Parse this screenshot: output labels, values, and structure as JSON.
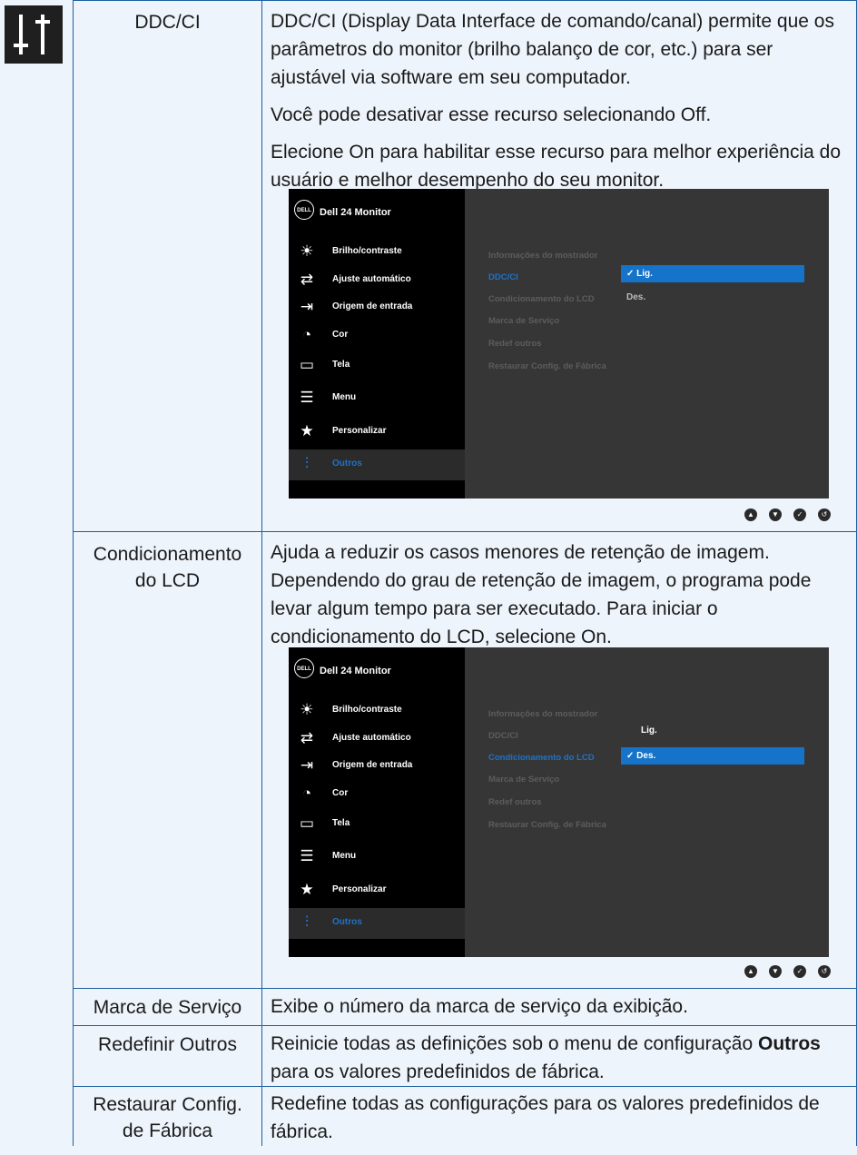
{
  "rows": [
    {
      "label": "DDC/CI",
      "desc": [
        "DDC/CI (Display Data Interface de comando/canal) permite que os parâmetros do monitor (brilho balanço de cor, etc.) para ser ajustável via software em seu computador.",
        "Você pode desativar esse recurso selecionando Off.",
        "Elecione On para habilitar esse recurso para melhor experiência do usuário e melhor desempenho do seu monitor."
      ]
    },
    {
      "label_line1": "Condicionamento",
      "label_line2": "do LCD",
      "desc": "Ajuda a reduzir os casos menores de retenção de imagem. Dependendo do grau de retenção de imagem, o programa pode levar algum tempo para ser executado. Para iniciar o condicionamento do LCD, selecione On."
    },
    {
      "label": "Marca de Serviço",
      "desc": "Exibe o número da marca de serviço da exibição."
    },
    {
      "label": "Redefinir Outros",
      "desc_before": "Reinicie todas as definições sob o menu de configuração ",
      "desc_bold": "Outros",
      "desc_after": " para os valores predefinidos de fábrica."
    },
    {
      "label_line1": "Restaurar Config.",
      "label_line2": "de Fábrica",
      "desc": "Redefine todas as configurações para os valores predefinidos de fábrica."
    }
  ],
  "osd": {
    "logo": "DELL",
    "title": "Dell 24 Monitor",
    "menu": [
      {
        "label": "Brilho/contraste",
        "icon": "brightness-icon"
      },
      {
        "label": "Ajuste automático",
        "icon": "auto-adjust-icon"
      },
      {
        "label": "Origem de entrada",
        "icon": "input-source-icon"
      },
      {
        "label": "Cor",
        "icon": "color-icon"
      },
      {
        "label": "Tela",
        "icon": "display-icon"
      },
      {
        "label": "Menu",
        "icon": "menu-icon"
      },
      {
        "label": "Personalizar",
        "icon": "star-icon"
      },
      {
        "label": "Outros",
        "icon": "others-icon"
      }
    ],
    "submenu": [
      "Informações do mostrador",
      "DDC/CI",
      "Condicionamento do LCD",
      "Marca de Serviço",
      "Redef outros",
      "Restaurar Config. de Fábrica"
    ],
    "screen1": {
      "ddc_value": "✓ Lig.",
      "lcd_value": "Des."
    },
    "screen2": {
      "ddc_value": "Lig.",
      "lcd_value": "✓ Des."
    },
    "buttons": [
      "up-icon",
      "down-icon",
      "check-icon",
      "back-icon"
    ]
  },
  "colors": {
    "accent": "#1573c9",
    "border": "#1d5fa0",
    "background": "#eef4fb"
  }
}
